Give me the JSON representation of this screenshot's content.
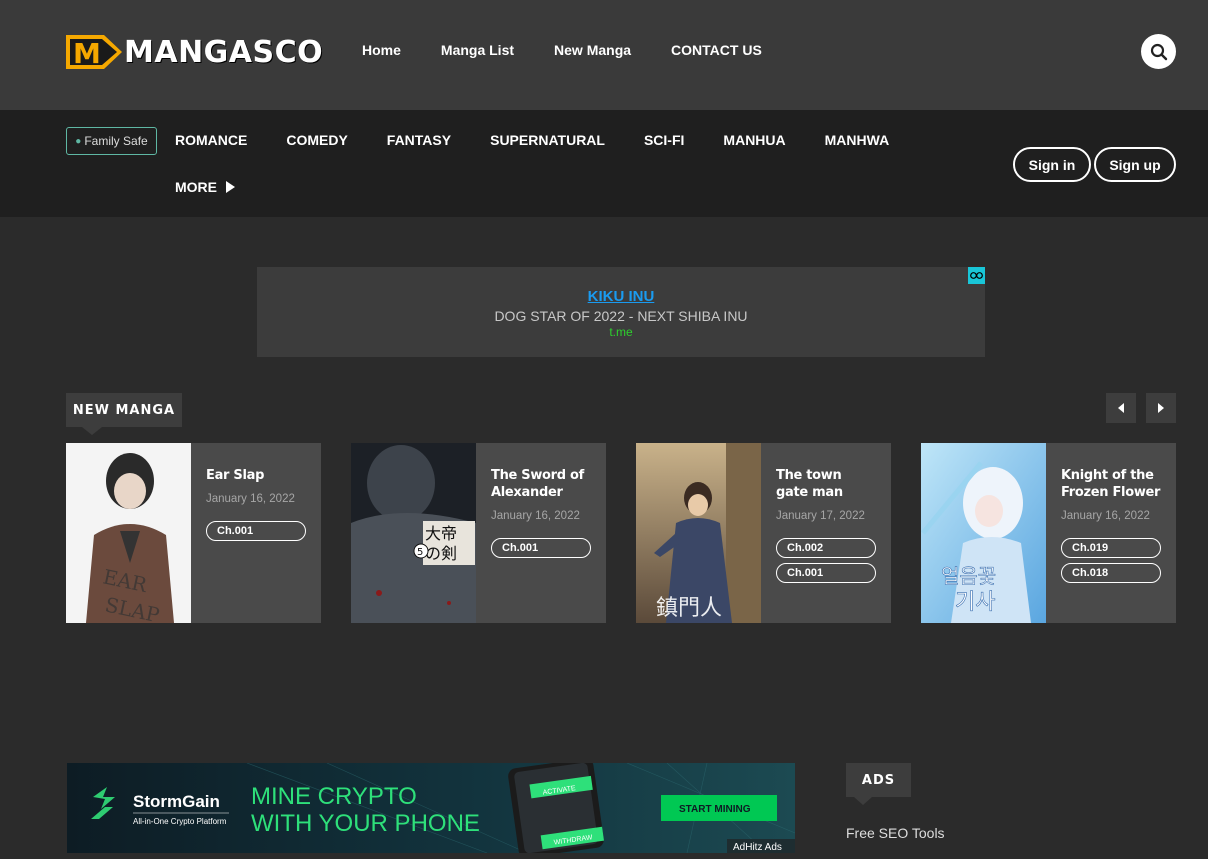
{
  "header": {
    "logo_text": "MANGASCO",
    "nav": [
      "Home",
      "Manga List",
      "New Manga",
      "CONTACT US"
    ]
  },
  "genre_bar": {
    "family_safe": "Family Safe",
    "genres": [
      "ROMANCE",
      "COMEDY",
      "FANTASY",
      "SUPERNATURAL",
      "SCI-FI",
      "MANHUA",
      "MANHWA"
    ],
    "more": "MORE",
    "sign_in": "Sign in",
    "sign_up": "Sign up"
  },
  "top_ad": {
    "title": "KIKU INU",
    "description": "DOG STAR OF 2022 - NEXT SHIBA INU",
    "url": "t.me"
  },
  "new_manga": {
    "heading": "NEW MANGA",
    "items": [
      {
        "title": "Ear Slap",
        "date": "January 16, 2022",
        "chapters": [
          "Ch.001"
        ],
        "cover_text": "EAR SLAP"
      },
      {
        "title": "The Sword of Alexander",
        "date": "January 16, 2022",
        "chapters": [
          "Ch.001"
        ],
        "cover_text": "大帝の剣"
      },
      {
        "title": "The town gate man",
        "date": "January 17, 2022",
        "chapters": [
          "Ch.002",
          "Ch.001"
        ],
        "cover_text": "鎮門人"
      },
      {
        "title": "Knight of the Frozen Flower",
        "date": "January 16, 2022",
        "chapters": [
          "Ch.019",
          "Ch.018"
        ],
        "cover_text": "얼음꽃 기사"
      }
    ]
  },
  "bottom_ad": {
    "brand": "StormGain",
    "brand_tagline": "All-in-One Crypto Platform",
    "headline_1": "MINE CRYPTO",
    "headline_2": "WITH YOUR PHONE",
    "phone_activate": "ACTIVATE",
    "phone_withdraw": "WITHDRAW",
    "cta": "START MINING",
    "network": "AdHitz Ads"
  },
  "sidebar": {
    "heading": "ADS",
    "link": "Free SEO Tools"
  },
  "colors": {
    "accent_green": "#00c853",
    "ad_link_blue": "#1a9bf0",
    "logo_yellow": "#f5a800"
  }
}
